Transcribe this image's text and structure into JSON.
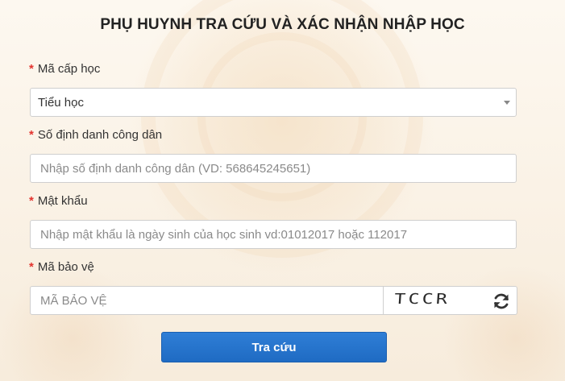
{
  "header": {
    "title": "PHỤ HUYNH TRA CỨU VÀ XÁC NHẬN NHẬP HỌC"
  },
  "form": {
    "required_marker": "*",
    "level": {
      "label": "Mã cấp học",
      "selected": "Tiểu học"
    },
    "citizen_id": {
      "label": "Số định danh công dân",
      "placeholder": "Nhập số định danh công dân (VD: 568645245651)"
    },
    "password": {
      "label": "Mật khẩu",
      "placeholder": "Nhập mật khẩu là ngày sinh của học sinh vd:01012017 hoặc 112017"
    },
    "captcha": {
      "label": "Mã bảo vệ",
      "placeholder": "MÃ BẢO VỆ",
      "image_text": "TCCR"
    },
    "submit_label": "Tra cứu"
  },
  "icons": {
    "refresh": "refresh-icon",
    "dropdown": "chevron-down-icon"
  },
  "colors": {
    "required": "#e3342f",
    "primary_button": "#1f6bc3",
    "background": "#fbf3e6"
  }
}
